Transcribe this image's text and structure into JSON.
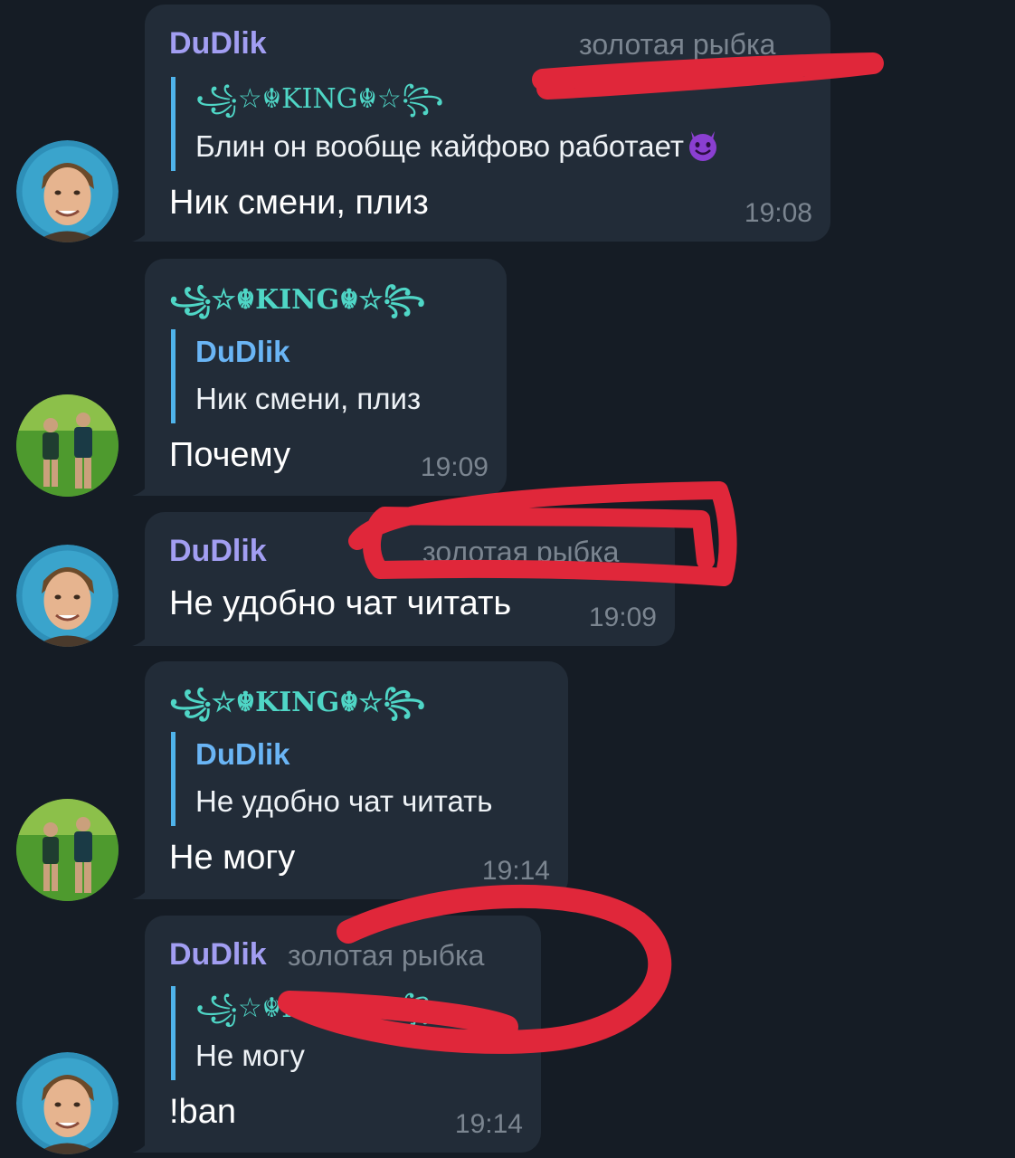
{
  "colors": {
    "background": "#151c25",
    "bubble": "#222c38",
    "admin_name": "#a29ef2",
    "king_name": "#4fd6c6",
    "reply_bar": "#4fb3ea",
    "reply_name": "#6ab5f5",
    "meta_text": "#7b8590",
    "scribble": "#e0273a"
  },
  "messages": [
    {
      "sender": "DuDlik",
      "title": "золотая рыбка",
      "reply_to": {
        "name": "꧁☆☬KING☬☆꧂",
        "text": "Блин он вообще кайфово работает",
        "emoji": "smiling-devil-emoji"
      },
      "text": "Ник смени, плиз",
      "time": "19:08",
      "avatar": "dexter-avatar"
    },
    {
      "sender": "꧁☆☬KING☬☆꧂",
      "reply_to": {
        "name": "DuDlik",
        "text": "Ник смени, плиз"
      },
      "text": "Почему",
      "time": "19:09",
      "avatar": "football-players-avatar"
    },
    {
      "sender": "DuDlik",
      "title": "золотая рыбка",
      "text": "Не удобно чат читать",
      "time": "19:09",
      "avatar": "dexter-avatar"
    },
    {
      "sender": "꧁☆☬KING☬☆꧂",
      "reply_to": {
        "name": "DuDlik",
        "text": "Не удобно чат читать"
      },
      "text": "Не могу",
      "time": "19:14",
      "avatar": "football-players-avatar"
    },
    {
      "sender": "DuDlik",
      "title": "золотая рыбка",
      "reply_to": {
        "name": "꧁☆☬KING☬☆꧂",
        "text": "Не могу"
      },
      "text": "!ban",
      "time": "19:14",
      "avatar": "dexter-avatar"
    }
  ]
}
